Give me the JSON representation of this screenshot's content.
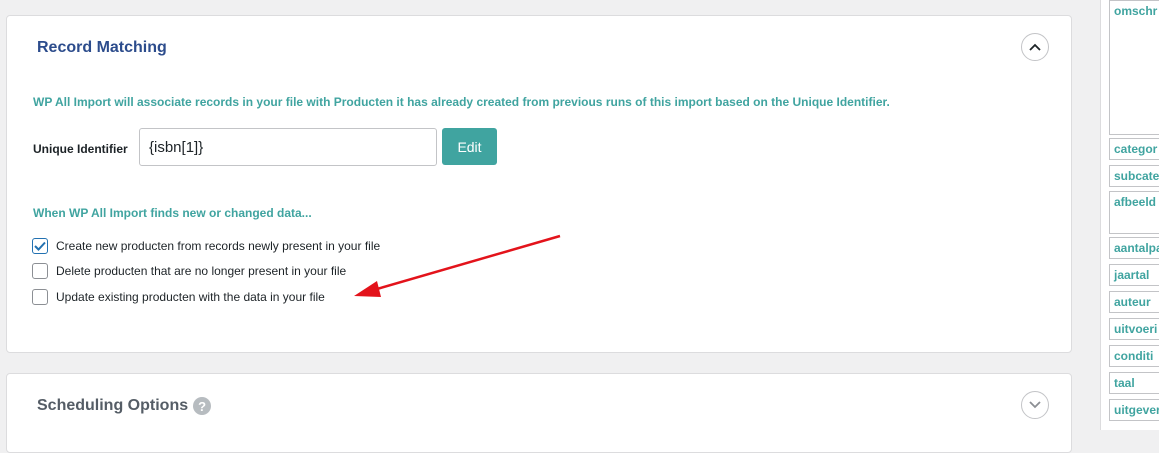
{
  "record_matching": {
    "title": "Record Matching",
    "description": "WP All Import will associate records in your file with Producten it has already created from previous runs of this import based on the Unique Identifier.",
    "unique_identifier_label": "Unique Identifier",
    "unique_identifier_value": "{isbn[1]}",
    "edit_label": "Edit",
    "changes_heading": "When WP All Import finds new or changed data...",
    "options": [
      {
        "label": "Create new producten from records newly present in your file",
        "checked": true
      },
      {
        "label": "Delete producten that are no longer present in your file",
        "checked": false
      },
      {
        "label": "Update existing producten with the data in your file",
        "checked": false
      }
    ]
  },
  "scheduling": {
    "title": "Scheduling Options",
    "help_glyph": "?"
  },
  "sidebar": {
    "fields": [
      "omschr",
      "categor",
      "subcate",
      "afbeeld",
      "aantalpa",
      "jaartal",
      "auteur",
      "uitvoeri",
      "conditi",
      "taal",
      "uitgever"
    ]
  },
  "colors": {
    "accent": "#40a4a0",
    "title": "#2c4c8c",
    "arrow": "#e3131b"
  }
}
